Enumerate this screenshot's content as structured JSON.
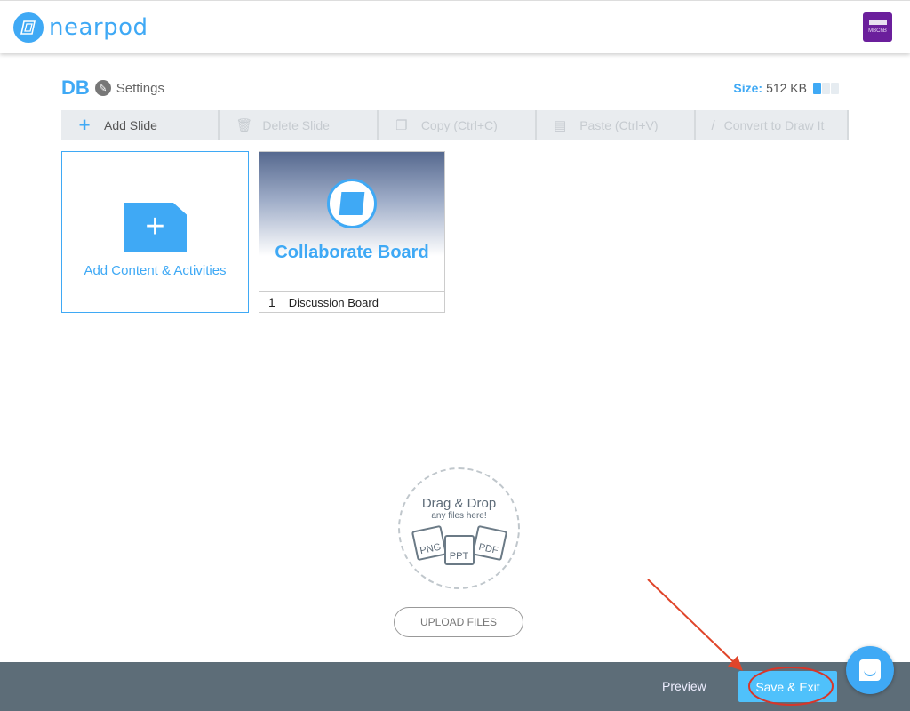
{
  "header": {
    "logo_text": "nearpod",
    "avatar_label": "MBChB"
  },
  "lesson": {
    "title": "DB",
    "settings_label": "Settings",
    "size_label": "Size:",
    "size_value": "512 KB",
    "size_fill_fraction": 0.33
  },
  "toolbar": [
    {
      "label": "Add Slide",
      "icon": "plus-icon",
      "enabled": true
    },
    {
      "label": "Delete Slide",
      "icon": "trash-icon",
      "enabled": false
    },
    {
      "label": "Copy (Ctrl+C)",
      "icon": "copy-icon",
      "enabled": false
    },
    {
      "label": "Paste (Ctrl+V)",
      "icon": "paste-icon",
      "enabled": false
    },
    {
      "label": "Convert to Draw It",
      "icon": "pencil-icon",
      "enabled": false
    }
  ],
  "add_card": {
    "label": "Add Content & Activities"
  },
  "slides": [
    {
      "number": "1",
      "thumb_title": "Collaborate Board",
      "name": "Discussion Board"
    }
  ],
  "dropzone": {
    "title": "Drag & Drop",
    "subtitle": "any files here!",
    "file_types": [
      "PNG",
      "PPT",
      "PDF"
    ],
    "upload_label": "UPLOAD FILES"
  },
  "footer": {
    "preview_label": "Preview",
    "save_label": "Save & Exit"
  },
  "colors": {
    "accent": "#3fa9f5",
    "footer": "#5d6d78",
    "save": "#4fc1fb",
    "annotation": "#e0452a",
    "avatar": "#6b1f9c"
  }
}
